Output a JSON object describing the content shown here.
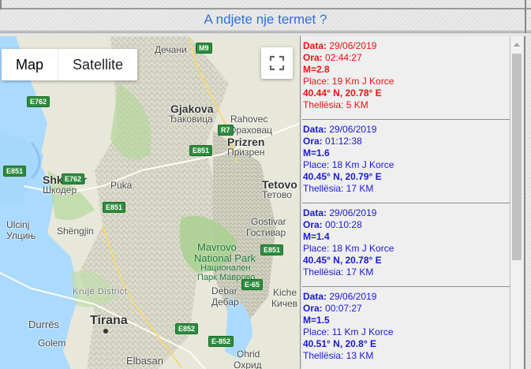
{
  "header": {
    "title": "A ndjete nje termet ?"
  },
  "map": {
    "controls": {
      "map_label": "Map",
      "satellite_label": "Satellite"
    },
    "labels": {
      "decan": "Дечани",
      "gjakova": "Gjakova",
      "gjakova_cyr": "Ђаковица",
      "rahovec": "Rahovec",
      "rahovec_cyr": "Ораховац",
      "prizren": "Prizren",
      "prizren_cyr": "Призрен",
      "pukа": "Puka",
      "shkoder": "Shkodër",
      "shkoder_cyr": "Шкодер",
      "ulcinj": "Ulcinj",
      "ulcinj_cyr": "Улцињ",
      "shengjin": "Shëngjin",
      "tetovo": "Tetovo",
      "tetovo_cyr": "Тетово",
      "gostivar": "Gostivar",
      "gostivar_cyr": "Гостивар",
      "mavrovo1": "Mavrovo",
      "mavrovo2": "National Park",
      "mavrovo3": "Национален",
      "mavrovo4": "Парк Маврово",
      "debar": "Debar",
      "debar_cyr": "Дебар",
      "kicevo": "Kiche",
      "kicevo_cyr": "Кичев",
      "kruje": "Krujë District",
      "durres": "Durrës",
      "tirana": "Tirana",
      "golem": "Golem",
      "elbasan": "Elbasan",
      "ohrid": "Ohrid",
      "ohrid_cyr": "Охрид"
    },
    "roads": [
      "M9",
      "E762",
      "R7",
      "E851",
      "E851",
      "E762",
      "E851",
      "E851",
      "E-65",
      "E852",
      "E-852"
    ]
  },
  "events": [
    {
      "data_label": "Data:",
      "data": "29/06/2019",
      "ora_label": "Ora:",
      "ora": "02:44:27",
      "magnitude": "M=2.8",
      "place_label": "Place:",
      "place": "19 Km J Korce",
      "coords": "40.44° N, 20.78° E",
      "depth_label": "Thellësia:",
      "depth": "5 KM",
      "color": "#ee1111"
    },
    {
      "data_label": "Data:",
      "data": "29/06/2019",
      "ora_label": "Ora:",
      "ora": "01:12:38",
      "magnitude": "M=1.6",
      "place_label": "Place:",
      "place": "18 Km J Korce",
      "coords": "40.45° N, 20.79° E",
      "depth_label": "Thellësia:",
      "depth": "17 KM",
      "color": "#1a1ad2"
    },
    {
      "data_label": "Data:",
      "data": "29/06/2019",
      "ora_label": "Ora:",
      "ora": "00:10:28",
      "magnitude": "M=1.4",
      "place_label": "Place:",
      "place": "18 Km J Korce",
      "coords": "40.45° N, 20.78° E",
      "depth_label": "Thellësia:",
      "depth": "17 KM",
      "color": "#1a1ad2"
    },
    {
      "data_label": "Data:",
      "data": "29/06/2019",
      "ora_label": "Ora:",
      "ora": "00:07:27",
      "magnitude": "M=1.5",
      "place_label": "Place:",
      "place": "11 Km J Korce",
      "coords": "40.51° N, 20.8° E",
      "depth_label": "Thellësia:",
      "depth": "13 KM",
      "color": "#1a1ad2"
    }
  ]
}
